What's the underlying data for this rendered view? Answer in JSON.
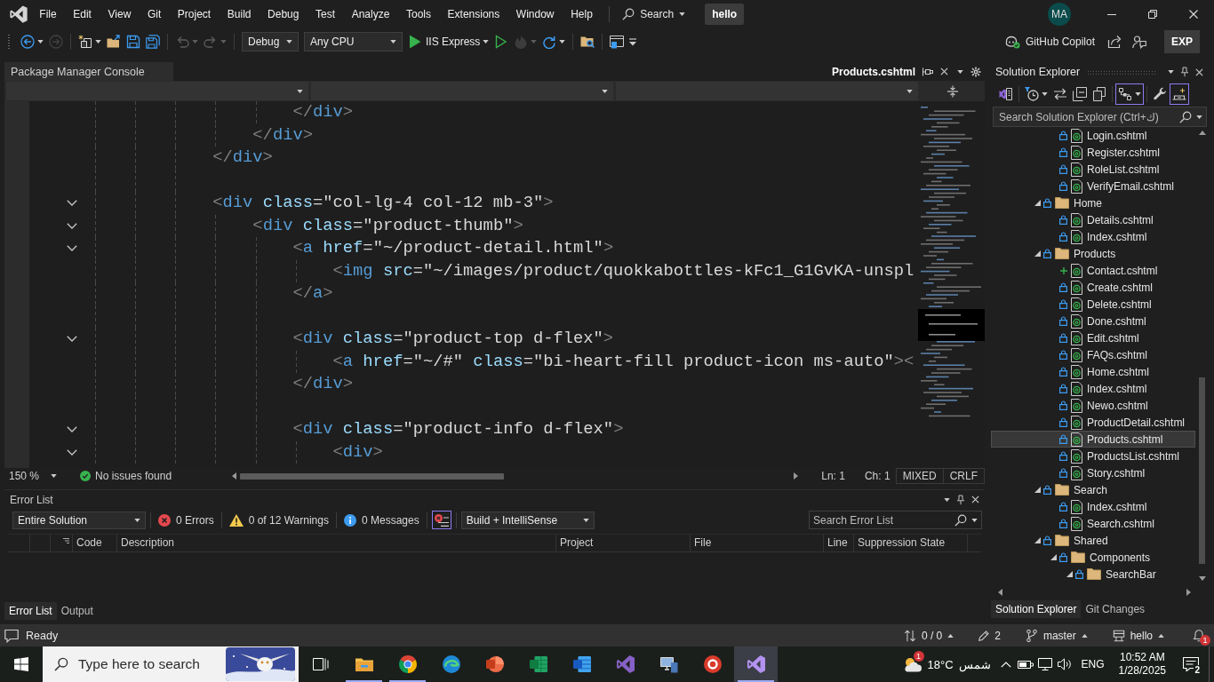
{
  "title_bar": {
    "menu": [
      "File",
      "Edit",
      "View",
      "Git",
      "Project",
      "Build",
      "Debug",
      "Test",
      "Analyze",
      "Tools",
      "Extensions",
      "Window",
      "Help"
    ],
    "search": "Search",
    "solution": "hello",
    "account": "MA"
  },
  "toolbar": {
    "items": [
      {
        "kind": "back",
        "disabled": false,
        "has_menu": true
      },
      {
        "kind": "forward",
        "disabled": true,
        "has_menu": false
      },
      {
        "kind": "separator"
      },
      {
        "kind": "new-item",
        "disabled": false,
        "has_menu": true
      },
      {
        "kind": "open",
        "disabled": false,
        "has_menu": false
      },
      {
        "kind": "save",
        "disabled": false,
        "has_menu": false
      },
      {
        "kind": "save-all",
        "disabled": false,
        "has_menu": false
      },
      {
        "kind": "separator"
      },
      {
        "kind": "undo",
        "disabled": true,
        "has_menu": true
      },
      {
        "kind": "redo",
        "disabled": true,
        "has_menu": true
      },
      {
        "kind": "separator"
      },
      {
        "kind": "configuration",
        "value": "Debug"
      },
      {
        "kind": "platform",
        "value": "Any CPU"
      },
      {
        "kind": "run",
        "label": "IIS Express",
        "disabled": false,
        "has_menu": true
      },
      {
        "kind": "run-without-debugging",
        "disabled": false,
        "has_menu": false
      },
      {
        "kind": "hot-reload",
        "disabled": true,
        "has_menu": true
      },
      {
        "kind": "restart",
        "disabled": false,
        "has_menu": true
      },
      {
        "kind": "separator"
      },
      {
        "kind": "folder-view",
        "disabled": false,
        "has_menu": false
      },
      {
        "kind": "separator"
      },
      {
        "kind": "window-layout",
        "disabled": false,
        "has_menu": false
      },
      {
        "kind": "overflow"
      }
    ],
    "copilot": "GitHub Copilot",
    "exp": "EXP"
  },
  "editor": {
    "console_tab": {
      "label": "Package Manager Console",
      "selected": false
    },
    "document_tab": {
      "label": "Products.cshtml",
      "selected": true
    },
    "lines": [
      {
        "kind": "code",
        "text": "                    </div>",
        "collapsible": false
      },
      {
        "kind": "code",
        "text": "                </div>",
        "collapsible": false
      },
      {
        "kind": "code",
        "text": "            </div>",
        "collapsible": false
      },
      {
        "kind": "blank"
      },
      {
        "kind": "code",
        "text": "            <div class=\"col-lg-4 col-12 mb-3\">",
        "collapsible": true
      },
      {
        "kind": "code",
        "text": "                <div class=\"product-thumb\">",
        "collapsible": true
      },
      {
        "kind": "code",
        "text": "                    <a href=\"~/product-detail.html\">",
        "collapsible": true
      },
      {
        "kind": "code",
        "text": "                        <img src=\"~/images/product/quokkabottles-kFc1_G1GvKA-unspl",
        "collapsible": false
      },
      {
        "kind": "code",
        "text": "                    </a>",
        "collapsible": false
      },
      {
        "kind": "blank"
      },
      {
        "kind": "code",
        "text": "                    <div class=\"product-top d-flex\">",
        "collapsible": true
      },
      {
        "kind": "code",
        "text": "                        <a href=\"~/#\" class=\"bi-heart-fill product-icon ms-auto\"><",
        "collapsible": false
      },
      {
        "kind": "code",
        "text": "                    </div>",
        "collapsible": false
      },
      {
        "kind": "blank"
      },
      {
        "kind": "code",
        "text": "                    <div class=\"product-info d-flex\">",
        "collapsible": true
      },
      {
        "kind": "code",
        "text": "                        <div>",
        "collapsible": true
      }
    ],
    "zoom": "150 %",
    "issues": "No issues found",
    "line": "Ln: 1",
    "column": "Ch: 1",
    "whitespace": "MIXED",
    "line_ending": "CRLF"
  },
  "error_list": {
    "title": "Error List",
    "scope": "Entire Solution",
    "errors": "0 Errors",
    "warnings": "0 of 12 Warnings",
    "messages": "0 Messages",
    "errors_only_filter": {
      "on": true
    },
    "source": "Build + IntelliSense",
    "search": {
      "placeholder": "Search Error List"
    },
    "columns": [
      "Code",
      "Description",
      "Project",
      "File",
      "Line",
      "Suppression State"
    ],
    "tabs": [
      {
        "label": "Error List",
        "selected": true
      },
      {
        "label": "Output",
        "selected": false
      }
    ]
  },
  "solution_explorer": {
    "title": "Solution Explorer",
    "toolbar": [
      {
        "kind": "home",
        "on": false,
        "has_menu": false
      },
      {
        "kind": "separator"
      },
      {
        "kind": "pending-changes-filter",
        "on": false,
        "has_menu": true
      },
      {
        "kind": "sync",
        "on": false,
        "has_menu": false
      },
      {
        "kind": "collapse-all",
        "on": false,
        "has_menu": false
      },
      {
        "kind": "switch-views",
        "on": false,
        "has_menu": false
      },
      {
        "kind": "separator"
      },
      {
        "kind": "show-all-files",
        "on": true,
        "has_menu": true
      },
      {
        "kind": "separator"
      },
      {
        "kind": "properties",
        "on": false,
        "has_menu": false
      },
      {
        "kind": "preview",
        "on": true,
        "has_menu": false
      }
    ],
    "search": {
      "placeholder": "Search Solution Explorer (Ctrl+ك)"
    },
    "tree": [
      {
        "children": [
          {
            "label": "Login.cshtml",
            "kind": "file",
            "added": false,
            "selected": false
          },
          {
            "label": "Register.cshtml",
            "kind": "file",
            "added": false,
            "selected": false
          },
          {
            "label": "RoleList.cshtml",
            "kind": "file",
            "added": false,
            "selected": false
          },
          {
            "label": "VerifyEmail.cshtml",
            "kind": "file",
            "added": false,
            "selected": false
          }
        ]
      },
      {
        "label": "Home",
        "kind": "folder",
        "added": false,
        "expanded": true,
        "selected": false,
        "children": [
          {
            "label": "Details.cshtml",
            "kind": "file",
            "added": false,
            "selected": false
          },
          {
            "label": "Index.cshtml",
            "kind": "file",
            "added": false,
            "selected": false
          }
        ]
      },
      {
        "label": "Products",
        "kind": "folder",
        "added": false,
        "expanded": true,
        "selected": false,
        "children": [
          {
            "label": "Contact.cshtml",
            "kind": "file",
            "added": true,
            "selected": false
          },
          {
            "label": "Create.cshtml",
            "kind": "file",
            "added": false,
            "selected": false
          },
          {
            "label": "Delete.cshtml",
            "kind": "file",
            "added": false,
            "selected": false
          },
          {
            "label": "Done.cshtml",
            "kind": "file",
            "added": false,
            "selected": false
          },
          {
            "label": "Edit.cshtml",
            "kind": "file",
            "added": false,
            "selected": false
          },
          {
            "label": "FAQs.cshtml",
            "kind": "file",
            "added": false,
            "selected": false
          },
          {
            "label": "Home.cshtml",
            "kind": "file",
            "added": false,
            "selected": false
          },
          {
            "label": "Index.cshtml",
            "kind": "file",
            "added": false,
            "selected": false
          },
          {
            "label": "Newo.cshtml",
            "kind": "file",
            "added": false,
            "selected": false
          },
          {
            "label": "ProductDetail.cshtml",
            "kind": "file",
            "added": false,
            "selected": false
          },
          {
            "label": "Products.cshtml",
            "kind": "file",
            "added": false,
            "selected": true
          },
          {
            "label": "ProductsList.cshtml",
            "kind": "file",
            "added": false,
            "selected": false
          },
          {
            "label": "Story.cshtml",
            "kind": "file",
            "added": false,
            "selected": false
          }
        ]
      },
      {
        "label": "Search",
        "kind": "folder",
        "added": false,
        "expanded": true,
        "selected": false,
        "children": [
          {
            "label": "Index.cshtml",
            "kind": "file",
            "added": false,
            "selected": false
          },
          {
            "label": "Search.cshtml",
            "kind": "file",
            "added": false,
            "selected": false
          }
        ]
      },
      {
        "label": "Shared",
        "kind": "folder",
        "added": false,
        "expanded": true,
        "selected": false,
        "children": [
          {
            "label": "Components",
            "kind": "folder",
            "added": false,
            "expanded": true,
            "selected": false,
            "children": [
              {
                "label": "SearchBar",
                "kind": "folder",
                "added": false,
                "expanded": true,
                "selected": false
              }
            ]
          }
        ]
      }
    ],
    "tabs": [
      {
        "label": "Solution Explorer",
        "selected": true
      },
      {
        "label": "Git Changes",
        "selected": false
      }
    ]
  },
  "status_bar": {
    "message": "Ready",
    "changes": "0 / 0",
    "pending": "2",
    "branch": "master",
    "repository": "hello",
    "notifications": "1"
  },
  "taskbar": {
    "search": {
      "placeholder": "Type here to search"
    },
    "apps": [
      {
        "kind": "task-view",
        "running": false,
        "selected": false
      },
      {
        "kind": "file-explorer",
        "running": true,
        "selected": false
      },
      {
        "kind": "browser",
        "running": true,
        "selected": false
      },
      {
        "kind": "browser-wave",
        "running": false,
        "selected": false
      },
      {
        "kind": "slides",
        "running": false,
        "selected": false
      },
      {
        "kind": "spreadsheet",
        "running": false,
        "selected": false
      },
      {
        "kind": "document",
        "running": false,
        "selected": false
      },
      {
        "kind": "ide",
        "running": false,
        "selected": false
      },
      {
        "kind": "remote",
        "running": false,
        "selected": false
      },
      {
        "kind": "round-app",
        "running": false,
        "selected": false
      },
      {
        "kind": "ide-preview",
        "running": true,
        "selected": true
      }
    ],
    "weather": {
      "temperature": "18°C",
      "condition": "شمس",
      "badge": "1"
    },
    "language": "ENG",
    "time": "10:52 AM",
    "date": "1/28/2025",
    "notifications": "2"
  }
}
